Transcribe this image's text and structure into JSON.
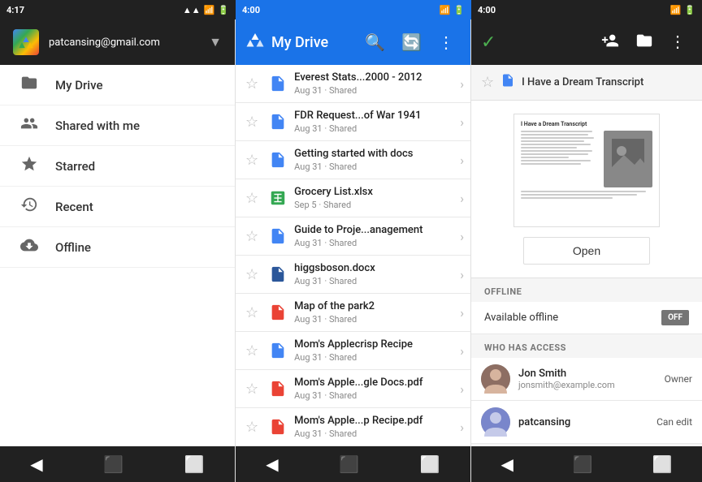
{
  "statusBars": {
    "left": {
      "time": "4:17",
      "icons": "📶🔋"
    },
    "mid": {
      "time": "4:00",
      "icons": "📶🔋"
    },
    "right": {
      "time": "4:00",
      "icons": "📶🔋"
    }
  },
  "leftPanel": {
    "email": "patcansing@gmail.com",
    "navItems": [
      {
        "id": "my-drive",
        "label": "My Drive",
        "icon": "🗂"
      },
      {
        "id": "shared-with-me",
        "label": "Shared with me",
        "icon": "👥"
      },
      {
        "id": "starred",
        "label": "Starred",
        "icon": "⭐"
      },
      {
        "id": "recent",
        "label": "Recent",
        "icon": "🕐"
      },
      {
        "id": "offline",
        "label": "Offline",
        "icon": "⬇"
      }
    ]
  },
  "midPanel": {
    "title": "My Drive",
    "files": [
      {
        "id": 1,
        "name": "Everest Stats...2000 - 2012",
        "date": "Aug 31",
        "shared": "Shared",
        "type": "doc"
      },
      {
        "id": 2,
        "name": "FDR Request...of War 1941",
        "date": "Aug 31",
        "shared": "Shared",
        "type": "doc"
      },
      {
        "id": 3,
        "name": "Getting started with docs",
        "date": "Aug 31",
        "shared": "Shared",
        "type": "doc"
      },
      {
        "id": 4,
        "name": "Grocery List.xlsx",
        "date": "Sep 5",
        "shared": "Shared",
        "type": "sheet"
      },
      {
        "id": 5,
        "name": "Guide to Proje...anagement",
        "date": "Aug 31",
        "shared": "Shared",
        "type": "doc"
      },
      {
        "id": 6,
        "name": "higgsboson.docx",
        "date": "Aug 31",
        "shared": "Shared",
        "type": "word"
      },
      {
        "id": 7,
        "name": "Map of the park2",
        "date": "Aug 31",
        "shared": "Shared",
        "type": "pdf"
      },
      {
        "id": 8,
        "name": "Mom's Applecrisp Recipe",
        "date": "Aug 31",
        "shared": "Shared",
        "type": "doc"
      },
      {
        "id": 9,
        "name": "Mom's Apple...gle Docs.pdf",
        "date": "Aug 31",
        "shared": "Shared",
        "type": "pdf"
      },
      {
        "id": 10,
        "name": "Mom's Apple...p Recipe.pdf",
        "date": "Aug 31",
        "shared": "Shared",
        "type": "pdf"
      }
    ]
  },
  "rightPanel": {
    "fileTitle": "I Have a Dream Transcript",
    "openButton": "Open",
    "offlineSection": "OFFLINE",
    "availableOfflineLabel": "Available offline",
    "availableOfflineValue": "OFF",
    "whoHasAccessSection": "WHO HAS ACCESS",
    "accessUsers": [
      {
        "name": "Jon Smith",
        "email": "jonsmith@example.com",
        "role": "Owner"
      },
      {
        "name": "patcansing",
        "email": "",
        "role": "Can edit"
      }
    ]
  },
  "bottomNav": {
    "backIcon": "◀",
    "homeIcon": "⬛",
    "recentIcon": "⬜"
  }
}
